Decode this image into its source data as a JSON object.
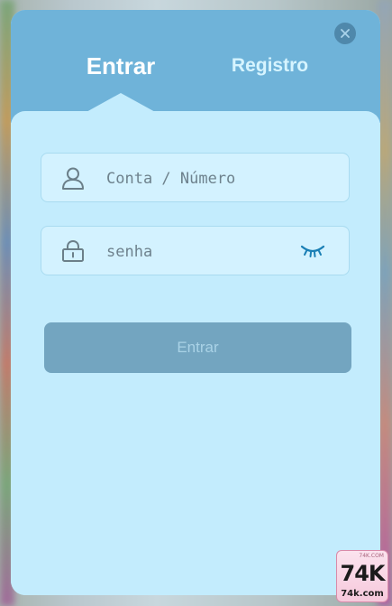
{
  "tabs": [
    {
      "label": "Entrar",
      "active": true
    },
    {
      "label": "Registro",
      "active": false
    }
  ],
  "close": {
    "icon": "close-icon"
  },
  "account_field": {
    "icon": "user-icon",
    "placeholder": "Conta / Número",
    "value": ""
  },
  "password_field": {
    "icon": "lock-icon",
    "placeholder": "senha",
    "value": "",
    "toggle_icon": "eye-closed-icon"
  },
  "submit": {
    "label": "Entrar",
    "enabled": false
  },
  "watermark": {
    "main": "74K",
    "sub": "74k.com",
    "top": "74K.COM"
  },
  "colors": {
    "header": "#6fb3d9",
    "panel": "#c3ecfd",
    "field_bg": "#d3f2ff",
    "button": "#73a5c0",
    "button_text": "#a9d2e6",
    "accent_eye": "#1a7fb5"
  }
}
